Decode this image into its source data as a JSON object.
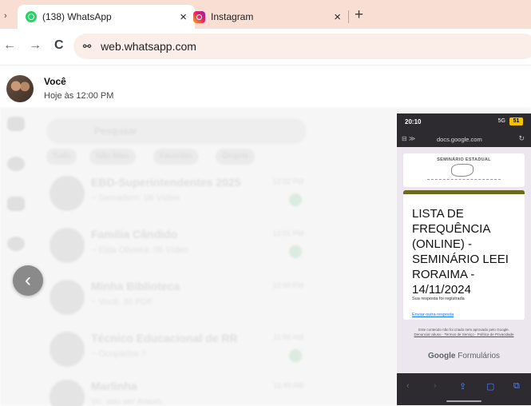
{
  "browser": {
    "tabs": [
      {
        "title": "(138) WhatsApp",
        "close": "×",
        "favicon": "whatsapp-icon"
      },
      {
        "title": "Instagram",
        "close": "×",
        "favicon": "instagram-icon"
      }
    ],
    "new_tab": "+",
    "url": "web.whatsapp.com"
  },
  "viewer": {
    "sender": "Você",
    "timestamp": "Hoje às 12:00 PM",
    "prev_icon": "chevron-left-icon"
  },
  "background_chats": {
    "search_placeholder": "Pesquisar",
    "chips": [
      "Tudo",
      "Não lidas",
      "Favoritas",
      "Grupos"
    ],
    "rows": [
      {
        "name": "EBD-Superintendentes 2025",
        "sub": "~ Semadern: 06 Vídeo",
        "time": "12:02 PM"
      },
      {
        "name": "Família Cândido",
        "sub": "~ Elda Oliveira: 06 Vídeo",
        "time": "12:01 PM"
      },
      {
        "name": "Minha Biblioteca",
        "sub": "~ Você: 30 PDF",
        "time": "12:00 PM"
      },
      {
        "name": "Técnico Educacional de RR",
        "sub": "~ Ocupadas ?",
        "time": "11:56 AM"
      },
      {
        "name": "Marlinha",
        "sub": "Vc: vou ver Anexo",
        "time": "11:49 AM"
      }
    ]
  },
  "phone": {
    "status_time": "20:10",
    "status_signal": "5G",
    "battery": "51",
    "url": "docs.google.com",
    "header_title": "SEMINÁRIO ESTADUAL",
    "form_title": "LISTA DE FREQUÊNCIA (ONLINE) - SEMINÁRIO LEEI RORAIMA - 14/11/2024",
    "response_recorded": "Sua resposta foi registrada",
    "submit_another": "Enviar outra resposta",
    "disclaimer": "Este conteúdo não foi criado nem aprovado pelo Google.",
    "disclaimer_links": "Denunciar abuso · Termos de Serviço · Política de Privacidade",
    "brand_google": "Google",
    "brand_forms": "Formulários"
  }
}
